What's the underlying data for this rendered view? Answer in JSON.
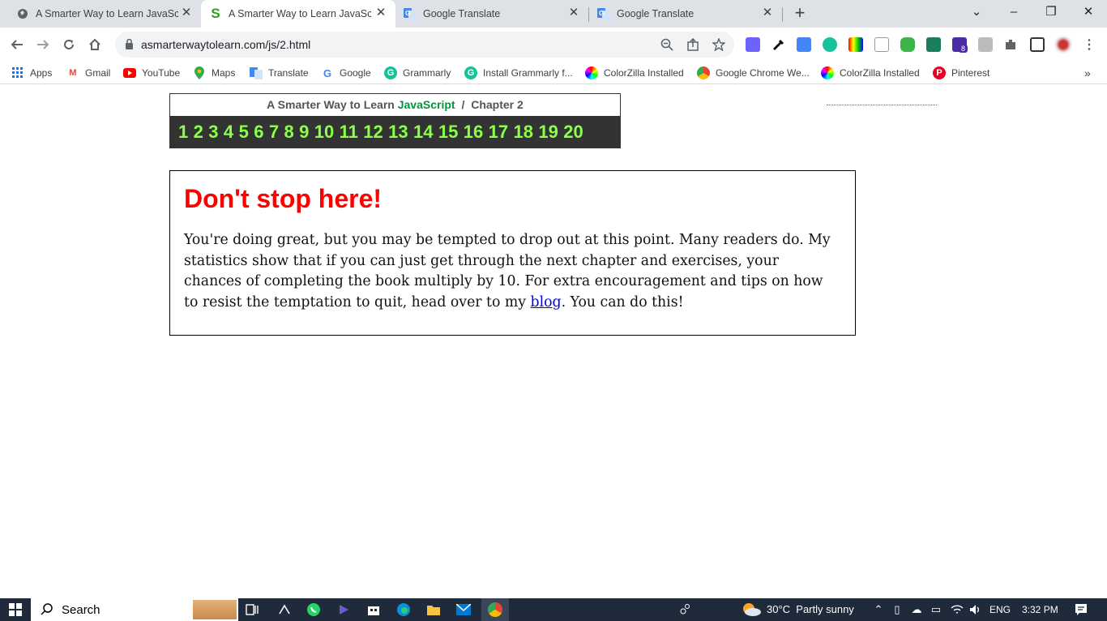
{
  "tabs": [
    {
      "title": "A Smarter Way to Learn JavaScrip",
      "favicon": "globe-icon"
    },
    {
      "title": "A Smarter Way to Learn JavaScrip",
      "favicon": "s-logo-icon"
    },
    {
      "title": "Google Translate",
      "favicon": "translate-icon"
    },
    {
      "title": "Google Translate",
      "favicon": "translate-icon"
    }
  ],
  "toolbar": {
    "url": "asmarterwaytolearn.com/js/2.html",
    "extension_badge": "8"
  },
  "bookmarks": [
    {
      "label": "Apps"
    },
    {
      "label": "Gmail"
    },
    {
      "label": "YouTube"
    },
    {
      "label": "Maps"
    },
    {
      "label": "Translate"
    },
    {
      "label": "Google"
    },
    {
      "label": "Grammarly"
    },
    {
      "label": "Install Grammarly f..."
    },
    {
      "label": "ColorZilla Installed"
    },
    {
      "label": "Google Chrome We..."
    },
    {
      "label": "ColorZilla Installed"
    },
    {
      "label": "Pinterest"
    }
  ],
  "page": {
    "header_prefix": "A Smarter Way to Learn",
    "header_js": "JavaScript",
    "header_sep": "/",
    "header_chapter": "Chapter 2",
    "chapters": [
      "1",
      "2",
      "3",
      "4",
      "5",
      "6",
      "7",
      "8",
      "9",
      "10",
      "11",
      "12",
      "13",
      "14",
      "15",
      "16",
      "17",
      "18",
      "19",
      "20"
    ],
    "heading": "Don't stop here!",
    "body_before": "You're doing great, but you may be tempted to drop out at this point. Many readers do. My statistics show that if you can just get through the next chapter and exercises, your chances of completing the book multiply by 10. For extra encouragement and tips on how to resist the temptation to quit, head over to my ",
    "link_text": "blog",
    "body_after": ". You can do this!"
  },
  "taskbar": {
    "search_label": "Search",
    "weather": "30°C  Partly sunny",
    "lang": "ENG",
    "time": "3:32 PM"
  }
}
